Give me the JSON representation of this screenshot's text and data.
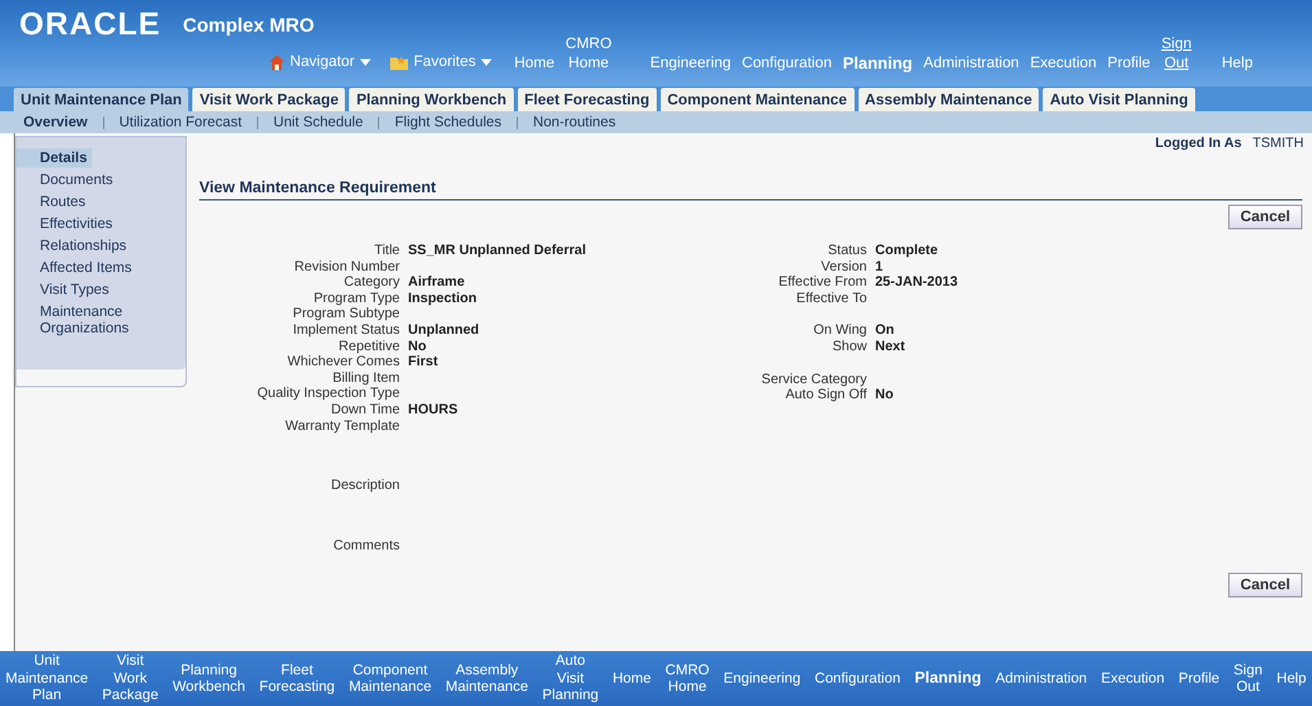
{
  "header": {
    "logo": "ORACLE",
    "app_name": "Complex MRO",
    "menus": [
      "Navigator",
      "Favorites"
    ],
    "global_links": [
      {
        "label": "Home",
        "selected": false
      },
      {
        "label": "CMRO Home",
        "selected": false
      },
      {
        "label": "Engineering",
        "selected": false
      },
      {
        "label": "Configuration",
        "selected": false
      },
      {
        "label": "Planning",
        "selected": true
      },
      {
        "label": "Administration",
        "selected": false
      },
      {
        "label": "Execution",
        "selected": false
      },
      {
        "label": "Profile",
        "selected": false
      },
      {
        "label": "Sign Out",
        "selected": false,
        "kind": "underlined"
      },
      {
        "label": "Help",
        "selected": false
      }
    ]
  },
  "tabs": [
    {
      "label": "Unit Maintenance Plan",
      "selected": true
    },
    {
      "label": "Visit Work Package",
      "selected": false
    },
    {
      "label": "Planning Workbench",
      "selected": false
    },
    {
      "label": "Fleet Forecasting",
      "selected": false
    },
    {
      "label": "Component Maintenance",
      "selected": false
    },
    {
      "label": "Assembly Maintenance",
      "selected": false
    },
    {
      "label": "Auto Visit Planning",
      "selected": false
    }
  ],
  "subtabs": [
    {
      "label": "Overview",
      "selected": true
    },
    {
      "label": "Utilization Forecast",
      "selected": false
    },
    {
      "label": "Unit Schedule",
      "selected": false
    },
    {
      "label": "Flight Schedules",
      "selected": false
    },
    {
      "label": "Non-routines",
      "selected": false
    }
  ],
  "side_nav": [
    {
      "label": "Details",
      "selected": true
    },
    {
      "label": "Documents",
      "selected": false
    },
    {
      "label": "Routes",
      "selected": false
    },
    {
      "label": "Effectivities",
      "selected": false
    },
    {
      "label": "Relationships",
      "selected": false
    },
    {
      "label": "Affected Items",
      "selected": false
    },
    {
      "label": "Visit Types",
      "selected": false
    },
    {
      "label": "Maintenance Organizations",
      "selected": false
    }
  ],
  "login": {
    "label": "Logged In As",
    "user": "TSMITH"
  },
  "page_title": "View Maintenance Requirement",
  "buttons": [
    "Cancel",
    "Cancel"
  ],
  "left_groups": [
    [
      {
        "label": "Title",
        "value": "SS_MR Unplanned Deferral"
      },
      {
        "label": "Revision Number"
      },
      {
        "label": "Category",
        "value": "Airframe"
      },
      {
        "label": "Program Type",
        "value": "Inspection"
      },
      {
        "label": "Program Subtype"
      },
      {
        "label": "Implement Status",
        "value": "Unplanned"
      },
      {
        "label": "Repetitive",
        "value": "No"
      },
      {
        "label": "Whichever Comes",
        "value": "First"
      },
      {
        "label": "Billing Item"
      },
      {
        "label": "Quality Inspection Type"
      },
      {
        "label": "Down Time",
        "value": "HOURS"
      },
      {
        "label": "Warranty Template"
      }
    ],
    [
      {
        "label": "Description"
      }
    ],
    [
      {
        "label": "Comments"
      }
    ]
  ],
  "right_groups": [
    [
      {
        "label": "Status",
        "value": "Complete"
      },
      {
        "label": "Version",
        "value": "1"
      },
      {
        "label": "Effective From",
        "value": "25-JAN-2013"
      },
      {
        "label": "Effective To"
      }
    ],
    [
      {
        "label": "On Wing",
        "value": "On"
      },
      {
        "label": "Show",
        "value": "Next"
      }
    ],
    [
      {
        "label": "Service Category"
      },
      {
        "label": "Auto Sign Off",
        "value": "No"
      }
    ]
  ],
  "footer_links": [
    {
      "label": "Unit Maintenance Plan",
      "selected": false
    },
    {
      "label": "Visit Work Package",
      "selected": false
    },
    {
      "label": "Planning Workbench",
      "selected": false
    },
    {
      "label": "Fleet Forecasting",
      "selected": false
    },
    {
      "label": "Component Maintenance",
      "selected": false
    },
    {
      "label": "Assembly Maintenance",
      "selected": false
    },
    {
      "label": "Auto Visit Planning",
      "selected": false
    },
    {
      "label": "Home",
      "selected": false
    },
    {
      "label": "CMRO Home",
      "selected": false
    },
    {
      "label": "Engineering",
      "selected": false
    },
    {
      "label": "Configuration",
      "selected": false
    },
    {
      "label": "Planning",
      "selected": true
    },
    {
      "label": "Administration",
      "selected": false
    },
    {
      "label": "Execution",
      "selected": false
    },
    {
      "label": "Profile",
      "selected": false
    },
    {
      "label": "Sign Out",
      "selected": false
    },
    {
      "label": "Help",
      "selected": false
    }
  ]
}
